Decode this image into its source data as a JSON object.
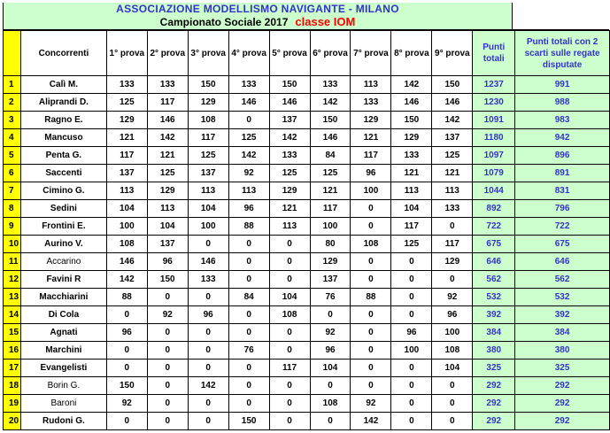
{
  "title": "ASSOCIAZIONE MODELLISMO NAVIGANTE - MILANO",
  "subtitle": "Campionato Sociale 2017",
  "class_label": "classe IOM",
  "columns": {
    "concorrenti": "Concorrenti",
    "prove": [
      "1° prova",
      "2° prova",
      "3° prova",
      "4° prova",
      "5° prova",
      "6° prova",
      "7° prova",
      "8° prova",
      "9° prova"
    ],
    "punti_totali": "Punti totali",
    "punti_scarti": "Punti totali con 2 scarti sulle regate disputate"
  },
  "rows": [
    {
      "rank": "1",
      "name": "Calì M.",
      "scores": [
        "133",
        "133",
        "150",
        "133",
        "150",
        "133",
        "113",
        "142",
        "150"
      ],
      "total": "1237",
      "net": "991"
    },
    {
      "rank": "2",
      "name": "Aliprandi D.",
      "scores": [
        "125",
        "117",
        "129",
        "146",
        "146",
        "142",
        "133",
        "146",
        "146"
      ],
      "total": "1230",
      "net": "988"
    },
    {
      "rank": "3",
      "name": "Ragno E.",
      "scores": [
        "129",
        "146",
        "108",
        "0",
        "137",
        "150",
        "129",
        "150",
        "142"
      ],
      "total": "1091",
      "net": "983"
    },
    {
      "rank": "4",
      "name": "Mancuso",
      "scores": [
        "121",
        "142",
        "117",
        "125",
        "142",
        "146",
        "121",
        "129",
        "137"
      ],
      "total": "1180",
      "net": "942"
    },
    {
      "rank": "5",
      "name": "Penta G.",
      "scores": [
        "117",
        "121",
        "125",
        "142",
        "133",
        "84",
        "117",
        "133",
        "125"
      ],
      "total": "1097",
      "net": "896"
    },
    {
      "rank": "6",
      "name": "Saccenti",
      "scores": [
        "137",
        "125",
        "137",
        "92",
        "125",
        "125",
        "96",
        "121",
        "121"
      ],
      "total": "1079",
      "net": "891"
    },
    {
      "rank": "7",
      "name": "Cimino G.",
      "scores": [
        "113",
        "129",
        "113",
        "113",
        "129",
        "121",
        "100",
        "113",
        "113"
      ],
      "total": "1044",
      "net": "831"
    },
    {
      "rank": "8",
      "name": "Sedini",
      "scores": [
        "104",
        "113",
        "104",
        "96",
        "121",
        "117",
        "0",
        "104",
        "133"
      ],
      "total": "892",
      "net": "796"
    },
    {
      "rank": "9",
      "name": "Frontini E.",
      "scores": [
        "100",
        "104",
        "100",
        "88",
        "113",
        "100",
        "0",
        "117",
        "0"
      ],
      "total": "722",
      "net": "722"
    },
    {
      "rank": "10",
      "name": "Aurino V.",
      "scores": [
        "108",
        "137",
        "0",
        "0",
        "0",
        "80",
        "108",
        "125",
        "117"
      ],
      "total": "675",
      "net": "675"
    },
    {
      "rank": "11",
      "name": "Accarino",
      "plain": true,
      "scores": [
        "146",
        "96",
        "146",
        "0",
        "0",
        "129",
        "0",
        "0",
        "129"
      ],
      "total": "646",
      "net": "646"
    },
    {
      "rank": "12",
      "name": "Favini R",
      "scores": [
        "142",
        "150",
        "133",
        "0",
        "0",
        "137",
        "0",
        "0",
        "0"
      ],
      "total": "562",
      "net": "562"
    },
    {
      "rank": "13",
      "name": "Macchiarini",
      "scores": [
        "88",
        "0",
        "0",
        "84",
        "104",
        "76",
        "88",
        "0",
        "92"
      ],
      "total": "532",
      "net": "532"
    },
    {
      "rank": "14",
      "name": "Di Cola",
      "scores": [
        "0",
        "92",
        "96",
        "0",
        "108",
        "0",
        "0",
        "0",
        "96"
      ],
      "total": "392",
      "net": "392"
    },
    {
      "rank": "15",
      "name": "Agnati",
      "scores": [
        "96",
        "0",
        "0",
        "0",
        "0",
        "92",
        "0",
        "96",
        "100"
      ],
      "total": "384",
      "net": "384"
    },
    {
      "rank": "16",
      "name": "Marchini",
      "scores": [
        "0",
        "0",
        "0",
        "76",
        "0",
        "96",
        "0",
        "100",
        "108"
      ],
      "total": "380",
      "net": "380"
    },
    {
      "rank": "17",
      "name": "Evangelisti",
      "scores": [
        "0",
        "0",
        "0",
        "0",
        "117",
        "104",
        "0",
        "0",
        "104"
      ],
      "total": "325",
      "net": "325"
    },
    {
      "rank": "18",
      "name": "Borin G.",
      "plain": true,
      "scores": [
        "150",
        "0",
        "142",
        "0",
        "0",
        "0",
        "0",
        "0",
        "0"
      ],
      "total": "292",
      "net": "292"
    },
    {
      "rank": "19",
      "name": "Baroni",
      "plain": true,
      "scores": [
        "92",
        "0",
        "0",
        "0",
        "0",
        "108",
        "92",
        "0",
        "0"
      ],
      "total": "292",
      "net": "292"
    },
    {
      "rank": "20",
      "name": "Rudoni G.",
      "scores": [
        "0",
        "0",
        "0",
        "150",
        "0",
        "0",
        "142",
        "0",
        "0"
      ],
      "total": "292",
      "net": "292"
    }
  ],
  "colors": {
    "rank_bg": "#ffff00",
    "total_bg": "#ccffcc",
    "total_text": "#3333cc",
    "title_text": "#3333cc",
    "class_text": "#ff0000"
  }
}
